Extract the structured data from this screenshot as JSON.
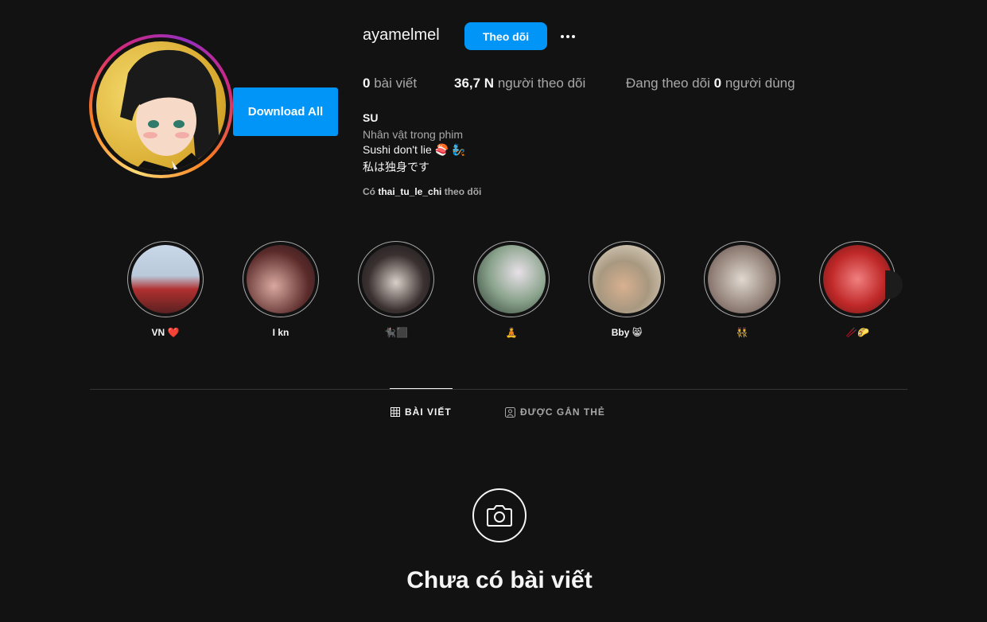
{
  "profile": {
    "username": "ayamelmel",
    "follow_label": "Theo dõi",
    "download_label": "Download All"
  },
  "stats": {
    "posts_count": "0",
    "posts_label": "bài viết",
    "followers_count": "36,7 N",
    "followers_label": "người theo dõi",
    "following_prefix": "Đang theo dõi",
    "following_count": "0",
    "following_suffix": "người dùng"
  },
  "bio": {
    "name": "SU",
    "category": "Nhân vật trong phim",
    "line1": "Sushi don't lie 🍣 🧞",
    "line2": "私は独身です",
    "followed_prefix": "Có",
    "followed_user": "thai_tu_le_chi",
    "followed_suffix": "theo dõi"
  },
  "highlights": [
    {
      "label": "VN ❤️"
    },
    {
      "label": "I kn"
    },
    {
      "label": "🐈‍⬛⬛"
    },
    {
      "label": "🧘"
    },
    {
      "label": "Bby 😸"
    },
    {
      "label": "👯"
    },
    {
      "label": "🥢🌮"
    }
  ],
  "tabs": {
    "posts": "BÀI VIẾT",
    "tagged": "ĐƯỢC GẮN THẺ"
  },
  "empty": {
    "title": "Chưa có bài viết"
  }
}
